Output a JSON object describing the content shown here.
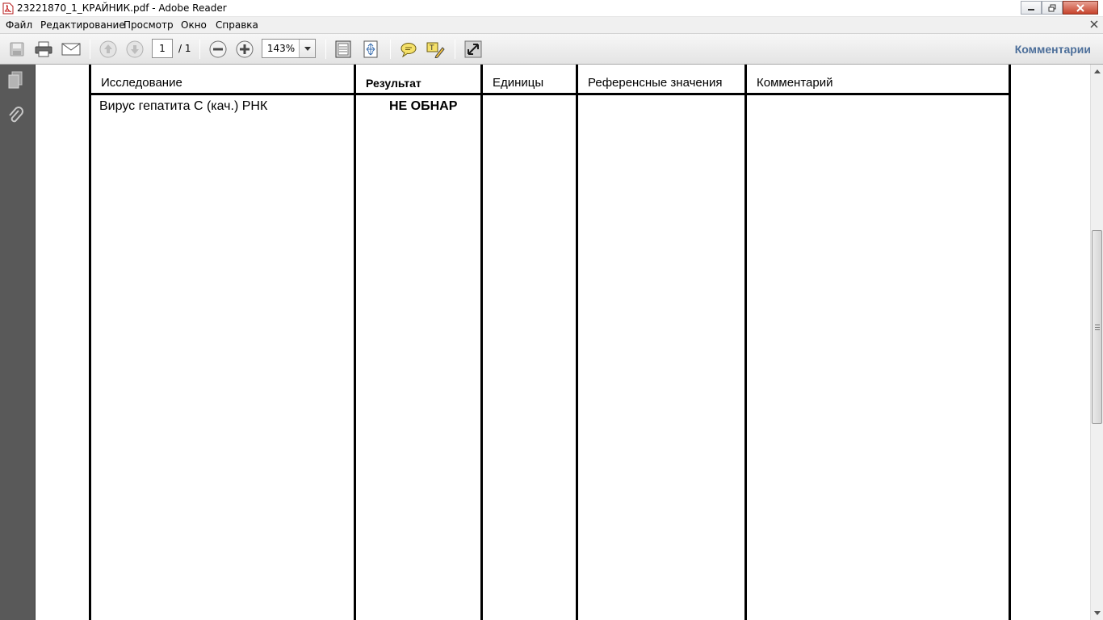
{
  "window": {
    "title": "23221870_1_КРАЙНИК.pdf - Adobe Reader",
    "icon": "pdf-file-icon"
  },
  "menu": {
    "items": [
      "Файл",
      "Редактирование",
      "Просмотр",
      "Окно",
      "Справка"
    ]
  },
  "toolbar": {
    "page_current": "1",
    "page_total": "/ 1",
    "zoom": "143%",
    "comments_label": "Комментарии"
  },
  "document": {
    "headers": [
      "Исследование",
      "Результат",
      "Единицы",
      "Референсные значения",
      "Комментарий"
    ],
    "rows": [
      {
        "test": "Вирус гепатита С (кач.) РНК",
        "result": "НЕ ОБНАР",
        "units": "",
        "reference": "",
        "comment": ""
      }
    ]
  },
  "colors": {
    "nav_panel": "#595959",
    "comments_link": "#4d6f9a",
    "close_button": "#c6432c"
  }
}
